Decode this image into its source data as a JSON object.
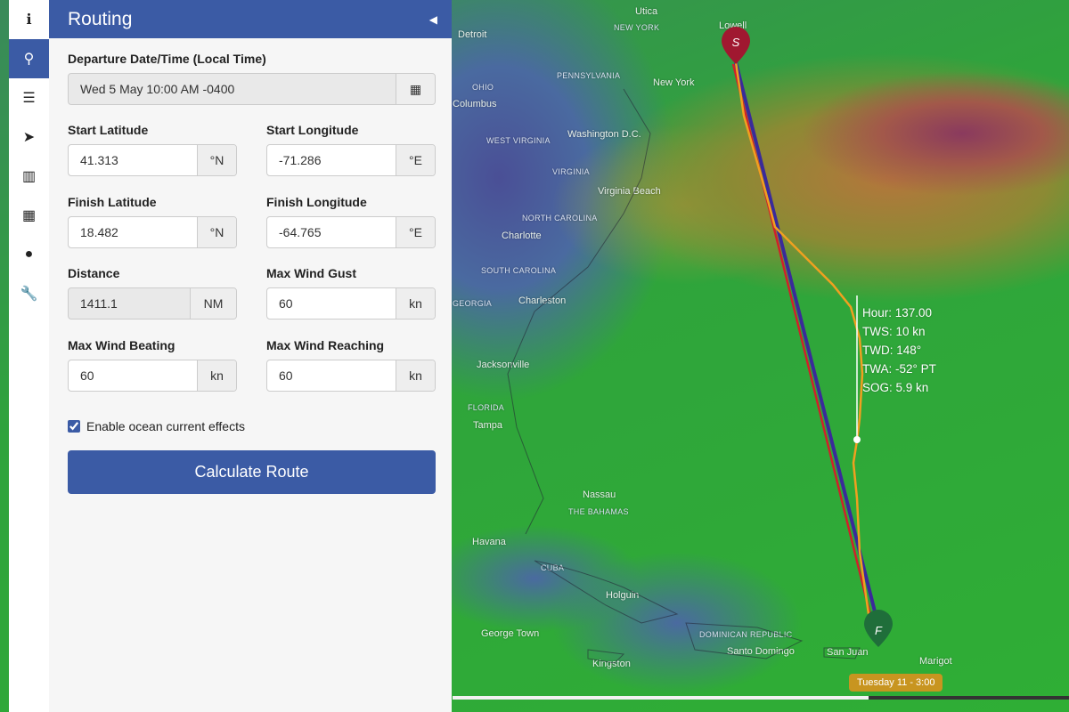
{
  "sidebar": {
    "items": [
      {
        "icon": "info-icon",
        "glyph": "ℹ"
      },
      {
        "icon": "map-marker-icon",
        "glyph": "⚲",
        "active": true
      },
      {
        "icon": "sliders-icon",
        "glyph": "☰"
      },
      {
        "icon": "navigation-arrow-icon",
        "glyph": "➤"
      },
      {
        "icon": "bar-chart-icon",
        "glyph": "▥"
      },
      {
        "icon": "calendar-icon",
        "glyph": "▦"
      },
      {
        "icon": "user-icon",
        "glyph": "●"
      },
      {
        "icon": "wrench-icon",
        "glyph": "🔧"
      }
    ]
  },
  "panel": {
    "title": "Routing",
    "collapse_glyph": "◀",
    "departure": {
      "label": "Departure Date/Time (Local Time)",
      "value": "Wed 5 May 10:00 AM -0400"
    },
    "start_lat": {
      "label": "Start Latitude",
      "value": "41.313",
      "unit": "°N"
    },
    "start_lon": {
      "label": "Start Longitude",
      "value": "-71.286",
      "unit": "°E"
    },
    "finish_lat": {
      "label": "Finish Latitude",
      "value": "18.482",
      "unit": "°N"
    },
    "finish_lon": {
      "label": "Finish Longitude",
      "value": "-64.765",
      "unit": "°E"
    },
    "distance": {
      "label": "Distance",
      "value": "1411.1",
      "unit": "NM"
    },
    "max_gust": {
      "label": "Max Wind Gust",
      "value": "60",
      "unit": "kn"
    },
    "max_beating": {
      "label": "Max Wind Beating",
      "value": "60",
      "unit": "kn"
    },
    "max_reaching": {
      "label": "Max Wind Reaching",
      "value": "60",
      "unit": "kn"
    },
    "ocean_current": {
      "label": "Enable ocean current effects",
      "checked": true
    },
    "calculate_label": "Calculate Route"
  },
  "map": {
    "labels": [
      "Detroit",
      "Utica",
      "NEW YORK",
      "Lowell",
      "PENNSYLVANIA",
      "OHIO",
      "Columbus",
      "New York",
      "WEST VIRGINIA",
      "Washington D.C.",
      "VIRGINIA",
      "Virginia Beach",
      "NORTH CAROLINA",
      "Charlotte",
      "SOUTH CAROLINA",
      "Charleston",
      "GEORGIA",
      "Jacksonville",
      "FLORIDA",
      "Tampa",
      "Nassau",
      "THE BAHAMAS",
      "Havana",
      "CUBA",
      "Holguin",
      "George Town",
      "Kingston",
      "DOMINICAN REPUBLIC",
      "Santo Domingo",
      "San Juan",
      "Marigot"
    ],
    "start_marker": "S",
    "finish_marker": "F",
    "route_colors": {
      "great_circle_red": "#d0202a",
      "rhumb_blue": "#3a2a9a",
      "optimal": "#f0a020"
    },
    "readout": {
      "hour": "Hour: 137.00",
      "tws": "TWS: 10 kn",
      "twd": "TWD: 148°",
      "twa": "TWA: -52° PT",
      "sog": "SOG: 5.9 kn"
    },
    "timeline": {
      "label": "Tuesday 11 - 3:00",
      "progress_percent": 67.5
    }
  }
}
